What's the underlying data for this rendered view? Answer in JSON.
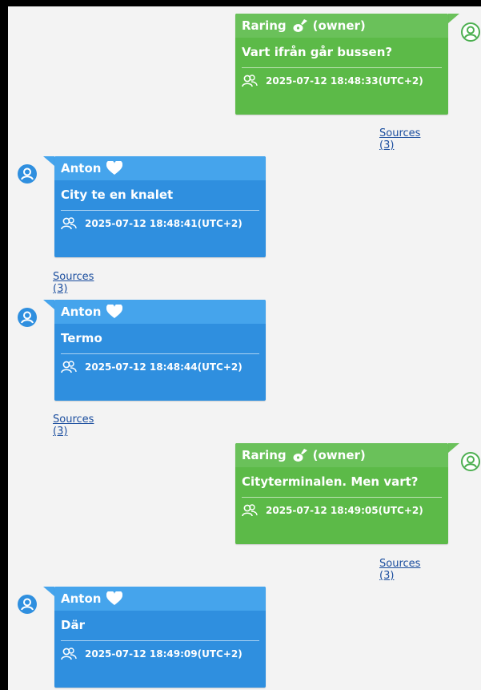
{
  "colors": {
    "owner_bubble": "#5cba48",
    "owner_header": "#6ac15a",
    "other_bubble": "#2f8fdf",
    "other_header": "#45a4ec",
    "owner_avatar": "#4caf50",
    "other_avatar": "#2f8fdf",
    "link": "#1a4d9e"
  },
  "messages": [
    {
      "side": "right",
      "author": "Raring",
      "author_icon": "guitar-icon",
      "role": "(owner)",
      "text": "Vart ifrån går bussen?",
      "timestamp": "2025-07-12 18:48:33(UTC+2)",
      "sources": "Sources (3)"
    },
    {
      "side": "left",
      "author": "Anton",
      "author_icon": "heart-icon",
      "role": "",
      "text": "City te en knalet",
      "timestamp": "2025-07-12 18:48:41(UTC+2)",
      "sources": "Sources (3)"
    },
    {
      "side": "left",
      "author": "Anton",
      "author_icon": "heart-icon",
      "role": "",
      "text": "Termo",
      "timestamp": "2025-07-12 18:48:44(UTC+2)",
      "sources": "Sources (3)"
    },
    {
      "side": "right",
      "author": "Raring",
      "author_icon": "guitar-icon",
      "role": "(owner)",
      "text": "Cityterminalen. Men vart?",
      "timestamp": "2025-07-12 18:49:05(UTC+2)",
      "sources": "Sources (3)"
    },
    {
      "side": "left",
      "author": "Anton",
      "author_icon": "heart-icon",
      "role": "",
      "text": "Där",
      "timestamp": "2025-07-12 18:49:09(UTC+2)",
      "sources": ""
    }
  ]
}
